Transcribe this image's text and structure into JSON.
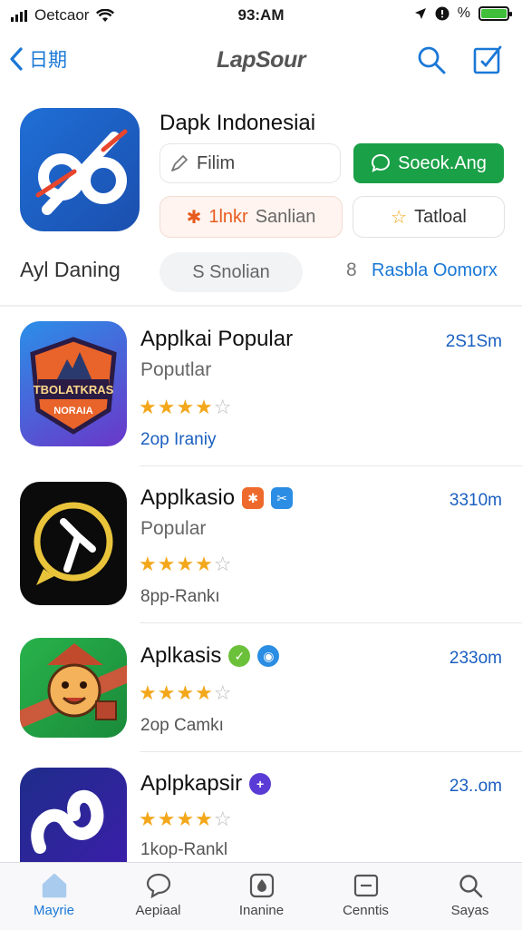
{
  "status": {
    "carrier": "Oetcaor",
    "time": "93:AM",
    "battery_pct": "%"
  },
  "nav": {
    "back_label": "日期",
    "title": "LapSour"
  },
  "hero": {
    "title": "Dapk Indonesiai",
    "film_label": "Filim",
    "primary_button": "Soeok.Ang",
    "tag_highlight": "1lnkr",
    "tag_text": "Sanlian",
    "tabel_label": "Tatloal",
    "row_label": "Ayl Daning",
    "secondary_pill": "S Snolian",
    "sort_number": "8",
    "sort_link": "Rasbla Oomorx"
  },
  "apps": [
    {
      "name": "Applkai Popular",
      "category": "Poputlar",
      "rating": 4,
      "rank": "2op Iraniy",
      "size": "2S1Sm",
      "icon_text": "TBOLATKRAS",
      "icon_sub": "NORAIA"
    },
    {
      "name": "Applkasio",
      "category": "Popular",
      "rating": 4,
      "rank": "8pp-Rankı",
      "size": "3310m"
    },
    {
      "name": "Aplkasis",
      "category": "",
      "rating": 4,
      "rank": "2op Camkı",
      "size": "233om"
    },
    {
      "name": "Aplpkapsir",
      "category": "",
      "rating": 4,
      "rank": "1kop-Rankl",
      "size": "23..om"
    }
  ],
  "tabs": [
    {
      "label": "Mayrie",
      "icon": "home-icon"
    },
    {
      "label": "Aepiaal",
      "icon": "chat-icon"
    },
    {
      "label": "Inanine",
      "icon": "drop-icon"
    },
    {
      "label": "Cenntis",
      "icon": "minus-box-icon"
    },
    {
      "label": "Sayas",
      "icon": "search-icon"
    }
  ],
  "colors": {
    "accent": "#1a78d6",
    "primary_button": "#1aa047",
    "star": "#f3a71b"
  }
}
